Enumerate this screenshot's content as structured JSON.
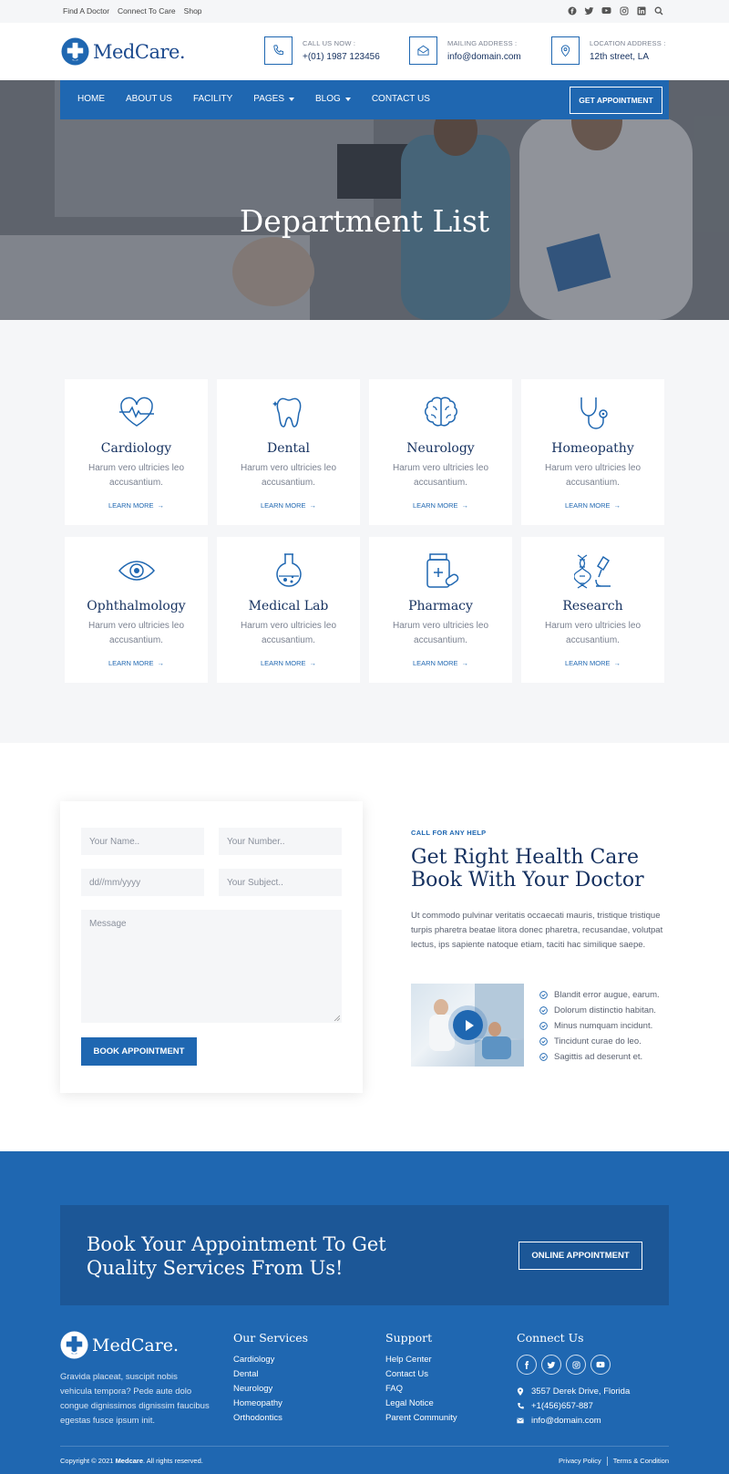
{
  "topbar": {
    "links": [
      "Find A Doctor",
      "Connect To Care",
      "Shop"
    ],
    "social_icons": [
      "facebook-icon",
      "twitter-icon",
      "youtube-icon",
      "instagram-icon",
      "linkedin-icon",
      "search-icon"
    ]
  },
  "brand": {
    "name": "MedCare."
  },
  "contacts": [
    {
      "label": "CALL US NOW :",
      "value": "+(01) 1987 123456",
      "icon": "phone-icon"
    },
    {
      "label": "MAILING ADDRESS :",
      "value": "info@domain.com",
      "icon": "mail-icon"
    },
    {
      "label": "LOCATION ADDRESS :",
      "value": "12th street, LA",
      "icon": "location-icon"
    }
  ],
  "nav": {
    "items": [
      {
        "label": "HOME",
        "dropdown": false
      },
      {
        "label": "ABOUT US",
        "dropdown": false
      },
      {
        "label": "FACILITY",
        "dropdown": false
      },
      {
        "label": "PAGES",
        "dropdown": true
      },
      {
        "label": "BLOG",
        "dropdown": true
      },
      {
        "label": "CONTACT US",
        "dropdown": false
      }
    ],
    "cta": "GET APPOINTMENT"
  },
  "hero": {
    "title": "Department List"
  },
  "departments": [
    {
      "title": "Cardiology",
      "desc": "Harum vero ultricies leo accusantium.",
      "more": "LEARN MORE",
      "icon": "heart-pulse-icon"
    },
    {
      "title": "Dental",
      "desc": "Harum vero ultricies leo accusantium.",
      "more": "LEARN MORE",
      "icon": "tooth-icon"
    },
    {
      "title": "Neurology",
      "desc": "Harum vero ultricies leo accusantium.",
      "more": "LEARN MORE",
      "icon": "brain-icon"
    },
    {
      "title": "Homeopathy",
      "desc": "Harum vero ultricies leo accusantium.",
      "more": "LEARN MORE",
      "icon": "stethoscope-icon"
    },
    {
      "title": "Ophthalmology",
      "desc": "Harum vero ultricies leo accusantium.",
      "more": "LEARN MORE",
      "icon": "eye-icon"
    },
    {
      "title": "Medical Lab",
      "desc": "Harum vero ultricies leo accusantium.",
      "more": "LEARN MORE",
      "icon": "flask-icon"
    },
    {
      "title": "Pharmacy",
      "desc": "Harum vero ultricies leo accusantium.",
      "more": "LEARN MORE",
      "icon": "medicine-bottle-icon"
    },
    {
      "title": "Research",
      "desc": "Harum vero ultricies leo accusantium.",
      "more": "LEARN MORE",
      "icon": "microscope-dna-icon"
    }
  ],
  "form": {
    "name_placeholder": "Your Name..",
    "number_placeholder": "Your Number..",
    "date_placeholder": "dd//mm/yyyy",
    "subject_placeholder": "Your Subject..",
    "message_placeholder": "Message",
    "submit": "BOOK APPOINTMENT"
  },
  "help": {
    "tag": "CALL FOR ANY HELP",
    "title": "Get Right Health Care Book With Your Doctor",
    "text": "Ut commodo pulvinar veritatis occaecati mauris, tristique tristique turpis pharetra beatae litora donec pharetra, recusandae, volutpat lectus, ips sapiente natoque etiam, taciti hac similique saepe.",
    "checklist": [
      "Blandit error augue, earum.",
      "Dolorum distinctio habitan.",
      "Minus numquam incidunt.",
      "Tincidunt curae do leo.",
      "Sagittis ad deserunt et."
    ]
  },
  "cta_banner": {
    "text": "Book Your Appointment To Get Quality Services From Us!",
    "button": "ONLINE APPOINTMENT"
  },
  "footer": {
    "brand": "MedCare.",
    "about": "Gravida placeat, suscipit nobis vehicula tempora? Pede aute dolo congue dignissimos dignissim faucibus egestas fusce ipsum init.",
    "services_title": "Our Services",
    "services": [
      "Cardiology",
      "Dental",
      "Neurology",
      "Homeopathy",
      "Orthodontics"
    ],
    "support_title": "Support",
    "support": [
      "Help Center",
      "Contact Us",
      "FAQ",
      "Legal Notice",
      "Parent Community"
    ],
    "connect_title": "Connect Us",
    "social_icons": [
      "facebook-icon",
      "twitter-icon",
      "instagram-icon",
      "youtube-icon"
    ],
    "contact": [
      {
        "icon": "location-pin-icon",
        "text": "3557 Derek Drive, Florida"
      },
      {
        "icon": "phone-icon",
        "text": "+1(456)657-887"
      },
      {
        "icon": "mail-icon",
        "text": "info@domain.com"
      }
    ],
    "copyright_prefix": "Copyright © 2021 ",
    "copyright_brand": "Medcare",
    "copyright_suffix": ". All rights reserved.",
    "legal": [
      "Privacy Policy",
      "Terms & Condition"
    ]
  },
  "colors": {
    "primary": "#1f67b1",
    "dark_navy": "#14305f",
    "cta_dark": "#1c5797",
    "section_bg": "#f5f6f8"
  }
}
